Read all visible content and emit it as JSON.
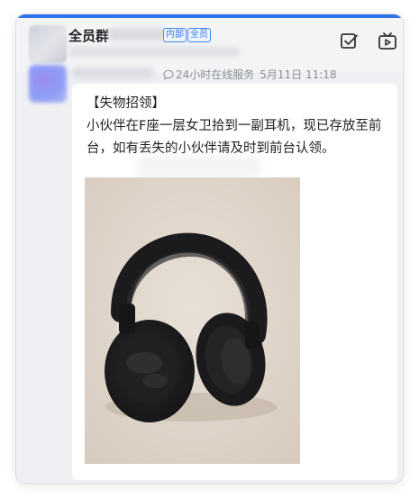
{
  "header": {
    "group_name": "全员群",
    "tags": [
      "内部",
      "全员"
    ]
  },
  "message": {
    "service_label": "24小时在线服务",
    "time": "5月11日 11:18",
    "lines": [
      "【失物招领】",
      "小伙伴在F座一层女卫拾到一副耳机，现已存放至前",
      "台，如有丢失的小伙伴请及时到前台认领。"
    ]
  },
  "icons": {
    "header": [
      "checkbox-icon",
      "tv-play-icon"
    ],
    "meta": "chat-bubble-icon"
  },
  "colors": {
    "accent": "#2f74e8",
    "tag": "#3a78ea",
    "meta_text": "#8b8f96"
  }
}
